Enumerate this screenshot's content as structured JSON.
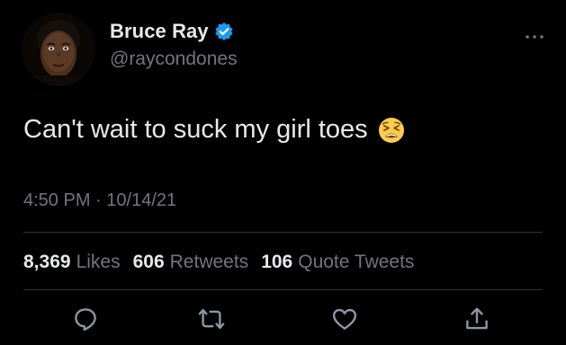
{
  "author": {
    "display_name": "Bruce Ray",
    "handle": "@raycondones",
    "verified_icon": "verified-badge-icon",
    "avatar": "profile-photo"
  },
  "tweet": {
    "text": "Can't wait to suck my girl toes",
    "emoji": "tired-face-emoji",
    "time": "4:50 PM",
    "separator": "·",
    "date": "10/14/21"
  },
  "stats": {
    "likes_count": "8,369",
    "likes_label": "Likes",
    "retweets_count": "606",
    "retweets_label": "Retweets",
    "quotes_count": "106",
    "quotes_label": "Quote Tweets"
  },
  "actions": [
    "reply-icon",
    "retweet-icon",
    "like-icon",
    "share-icon"
  ],
  "colors": {
    "background": "#000000",
    "primary_text": "#e7e9ea",
    "secondary_text": "#71767b",
    "verified": "#1d9bf0",
    "divider": "#2f3336"
  }
}
